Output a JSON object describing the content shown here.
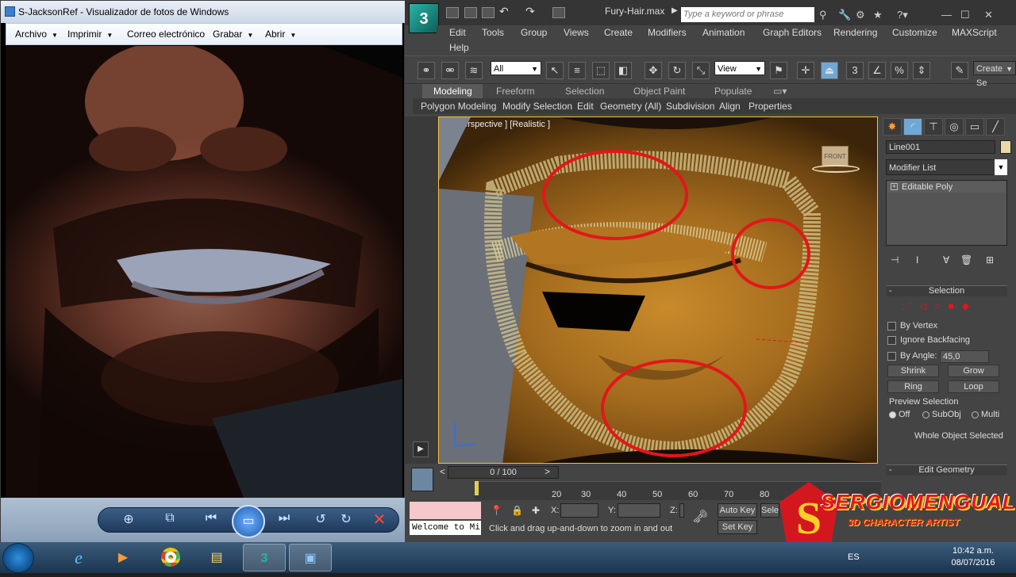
{
  "photo_viewer": {
    "title": "S-JacksonRef - Visualizador de fotos de Windows",
    "menu": [
      "Archivo",
      "Imprimir",
      "Correo electrónico",
      "Grabar",
      "Abrir"
    ],
    "nav_icons": [
      "zoom-icon",
      "fit-window-icon",
      "previous-icon",
      "slideshow-icon",
      "next-icon",
      "rotate-left-icon",
      "rotate-right-icon",
      "delete-icon"
    ]
  },
  "max": {
    "file_name": "Fury-Hair.max",
    "search_placeholder": "Type a keyword or phrase",
    "menu": [
      "Edit",
      "Tools",
      "Group",
      "Views",
      "Create",
      "Modifiers",
      "Animation",
      "Graph Editors",
      "Rendering",
      "Customize",
      "MAXScript",
      "Help"
    ],
    "toolbar": {
      "selection_filter": "All",
      "ref_coord": "View",
      "snap_label": "3",
      "create_selection": "Create Se"
    },
    "ribbon_tabs": [
      "Modeling",
      "Freeform",
      "Selection",
      "Object Paint",
      "Populate"
    ],
    "ribbon_panels": [
      "Polygon Modeling",
      "Modify Selection",
      "Edit",
      "Geometry (All)",
      "Subdivision",
      "Align",
      "Properties"
    ],
    "viewport_label": "[+] [Perspective ] [Realistic ]",
    "viewcube_label": "FRONT",
    "command_panel": {
      "object_name": "Line001",
      "object_color": "#ebd9a4",
      "modifier_list": "Modifier List",
      "stack_item": "Editable Poly",
      "selection_rollout": "Selection",
      "by_vertex": "By Vertex",
      "ignore_backfacing": "Ignore Backfacing",
      "by_angle": "By Angle:",
      "by_angle_value": "45,0",
      "shrink": "Shrink",
      "grow": "Grow",
      "ring": "Ring",
      "loop": "Loop",
      "preview_selection": "Preview Selection",
      "preview_options": [
        "Off",
        "SubObj",
        "Multi"
      ],
      "preview_selected": "Off",
      "status": "Whole Object Selected",
      "edit_geometry": "Edit Geometry"
    },
    "timeline": {
      "frame_display": "0 / 100",
      "ticks": [
        "20",
        "30",
        "40",
        "50",
        "60",
        "70",
        "80"
      ]
    },
    "status_bar": {
      "listener": "Welcome to Mi",
      "prompt": "Click and drag up-and-down to zoom in and out",
      "coord_labels": [
        "X:",
        "Y:",
        "Z:"
      ],
      "auto_key": "Auto Key",
      "set_key": "Set Key",
      "selected": "Sele"
    }
  },
  "taskbar": {
    "apps": [
      "ie-icon",
      "media-center-icon",
      "chrome-icon",
      "explorer-icon",
      "3dsmax-icon",
      "photo-viewer-icon"
    ],
    "language": "ES",
    "time": "10:42 a.m.",
    "date": "08/07/2016"
  },
  "watermark": {
    "initial": "S",
    "name": "SERGIOMENGUAL",
    "tagline": "3D CHARACTER ARTIST"
  },
  "annotation_color": "#e3161a"
}
